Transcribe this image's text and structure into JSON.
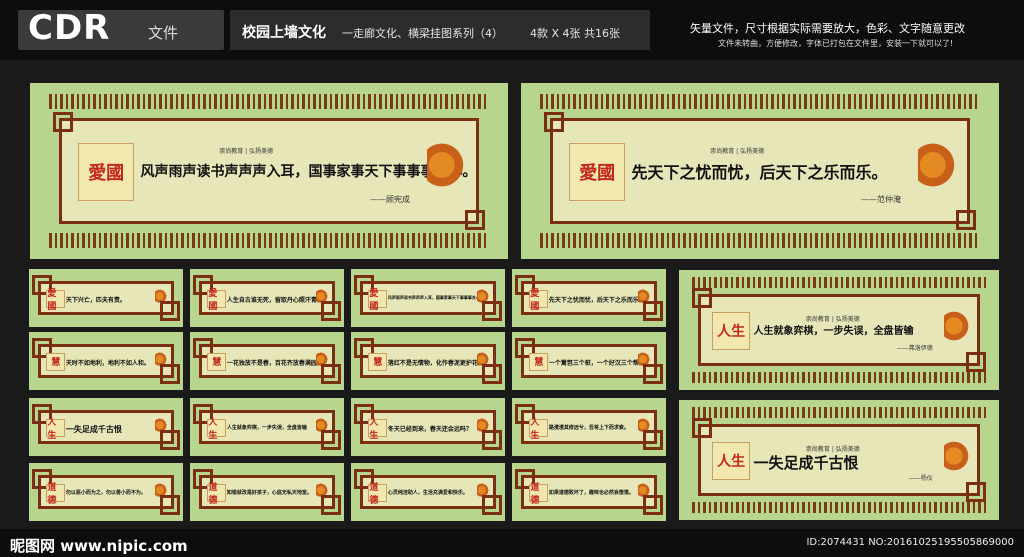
{
  "header": {
    "cdr_big": "CDR",
    "cdr_small": "文件",
    "title_main": "校园上墙文化",
    "title_sub": "一走廊文化、横梁挂图系列（4）",
    "title_count": "4款 X 4张  共16张",
    "notice1": "矢量文件，尺寸根据实际需要放大，色彩、文字随意更改",
    "notice2": "文件未转曲，方便修改，字体已打包在文件里，安装一下就可以了!"
  },
  "panels": [
    {
      "badge": "愛國",
      "quote": "风声雨声读书声声声入耳，国事家事天下事事事关心。",
      "author": "——顾宪成",
      "header": "崇尚教育 | 弘扬美德"
    },
    {
      "badge": "愛國",
      "quote": "先天下之忧而忧，后天下之乐而乐。",
      "author": "——范仲淹",
      "header": "崇尚教育 | 弘扬美德"
    },
    {
      "badge": "愛國",
      "quote": "天下兴亡，匹夫有责。"
    },
    {
      "badge": "愛國",
      "quote": "人生自古谁无死，留取丹心照汗青。"
    },
    {
      "badge": "愛國",
      "quote": "风声雨声读书声声声入耳，国事家事天下事事事关心。"
    },
    {
      "badge": "愛國",
      "quote": "先天下之忧而忧，后天下之乐而乐。"
    },
    {
      "badge": "人生",
      "quote": "人生就象弈棋，一步失误，全盘皆输",
      "author": "——弗洛伊德",
      "header": "崇尚教育 | 弘扬美德"
    },
    {
      "badge": "慧",
      "quote": "天时不如地利，地利不如人和。"
    },
    {
      "badge": "慧",
      "quote": "一花独放不是春，百花齐放春满园。"
    },
    {
      "badge": "慧",
      "quote": "落红不是无情物，化作春泥更护花。"
    },
    {
      "badge": "慧",
      "quote": "一个篱笆三个桩，一个好汉三个帮。"
    },
    {
      "badge": "人生",
      "quote": "一失足成千古恨"
    },
    {
      "badge": "人生",
      "quote": "人生就象弈棋，一步失误，全盘皆输"
    },
    {
      "badge": "人生",
      "quote": "冬天已经到来，春天还会远吗？"
    },
    {
      "badge": "人生",
      "quote": "路漫漫其修远兮，吾将上下而求索。"
    },
    {
      "badge": "人生",
      "quote": "一失足成千古恨",
      "author": "——杨仪",
      "header": "崇尚教育 | 弘扬美德"
    },
    {
      "badge": "道德",
      "quote": "勿以恶小而为之，勿以善小而不为。"
    },
    {
      "badge": "道德",
      "quote": "知错就改是好孩子，心底无私天地宽。"
    },
    {
      "badge": "道德",
      "quote": "心灵纯洁助人，生活充满爱和快乐。"
    },
    {
      "badge": "道德",
      "quote": "如果道德败坏了，趣味也必然会堕落。"
    }
  ],
  "footer": {
    "logo": "昵图网 www.nipic.com",
    "id": "ID:2074431 NO:20161025195505869000"
  }
}
